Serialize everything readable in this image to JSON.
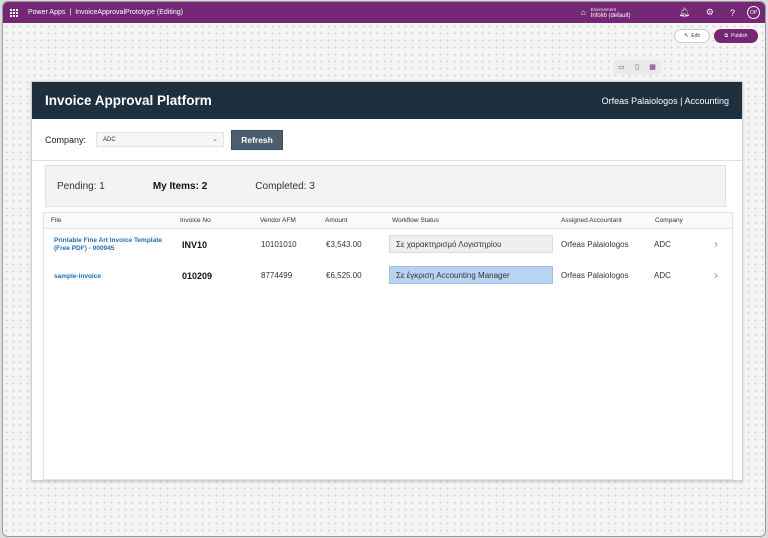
{
  "topbar": {
    "app_name": "Power Apps",
    "separator": "|",
    "doc_title": "InvoiceApprovalPrototype (Editing)",
    "env_label": "Environment",
    "env_name": "Infolib (default)",
    "avatar_initials": "OP"
  },
  "studio": {
    "edit_label": "Edit",
    "publish_label": "Publish"
  },
  "app": {
    "title": "Invoice Approval Platform",
    "user": "Orfeas Palaiologos | Accounting",
    "filter": {
      "company_label": "Company:",
      "company_value": "ADC",
      "refresh_label": "Refresh"
    },
    "stats": {
      "pending": "Pending: 1",
      "my_items": "My Items: 2",
      "completed": "Completed: 3"
    },
    "table": {
      "headers": [
        "File",
        "Invoice No",
        "Vendor AFM",
        "Amount",
        "Workflow Status",
        "Assigned Accountant",
        "Company"
      ],
      "rows": [
        {
          "file": "Printable Fine Art Invoice Template (Free PDF) - 000945",
          "invoice_no": "INV10",
          "vendor_afm": "10101010",
          "amount": "€3,543.00",
          "status": "Σε χαρακτηρισμό Λογιστηρίου",
          "accountant": "Orfeas Palaiologos",
          "company": "ADC"
        },
        {
          "file": "sample-invoice",
          "invoice_no": "010209",
          "vendor_afm": "8774499",
          "amount": "€6,525.00",
          "status": "Σε έγκριση Accounting Manager",
          "accountant": "Orfeas Palaiologos",
          "company": "ADC"
        }
      ]
    }
  },
  "colors": {
    "brand": "#742774",
    "header": "#1e2f3d",
    "link": "#1a6fb5",
    "status_highlight": "#b9d4f2"
  }
}
